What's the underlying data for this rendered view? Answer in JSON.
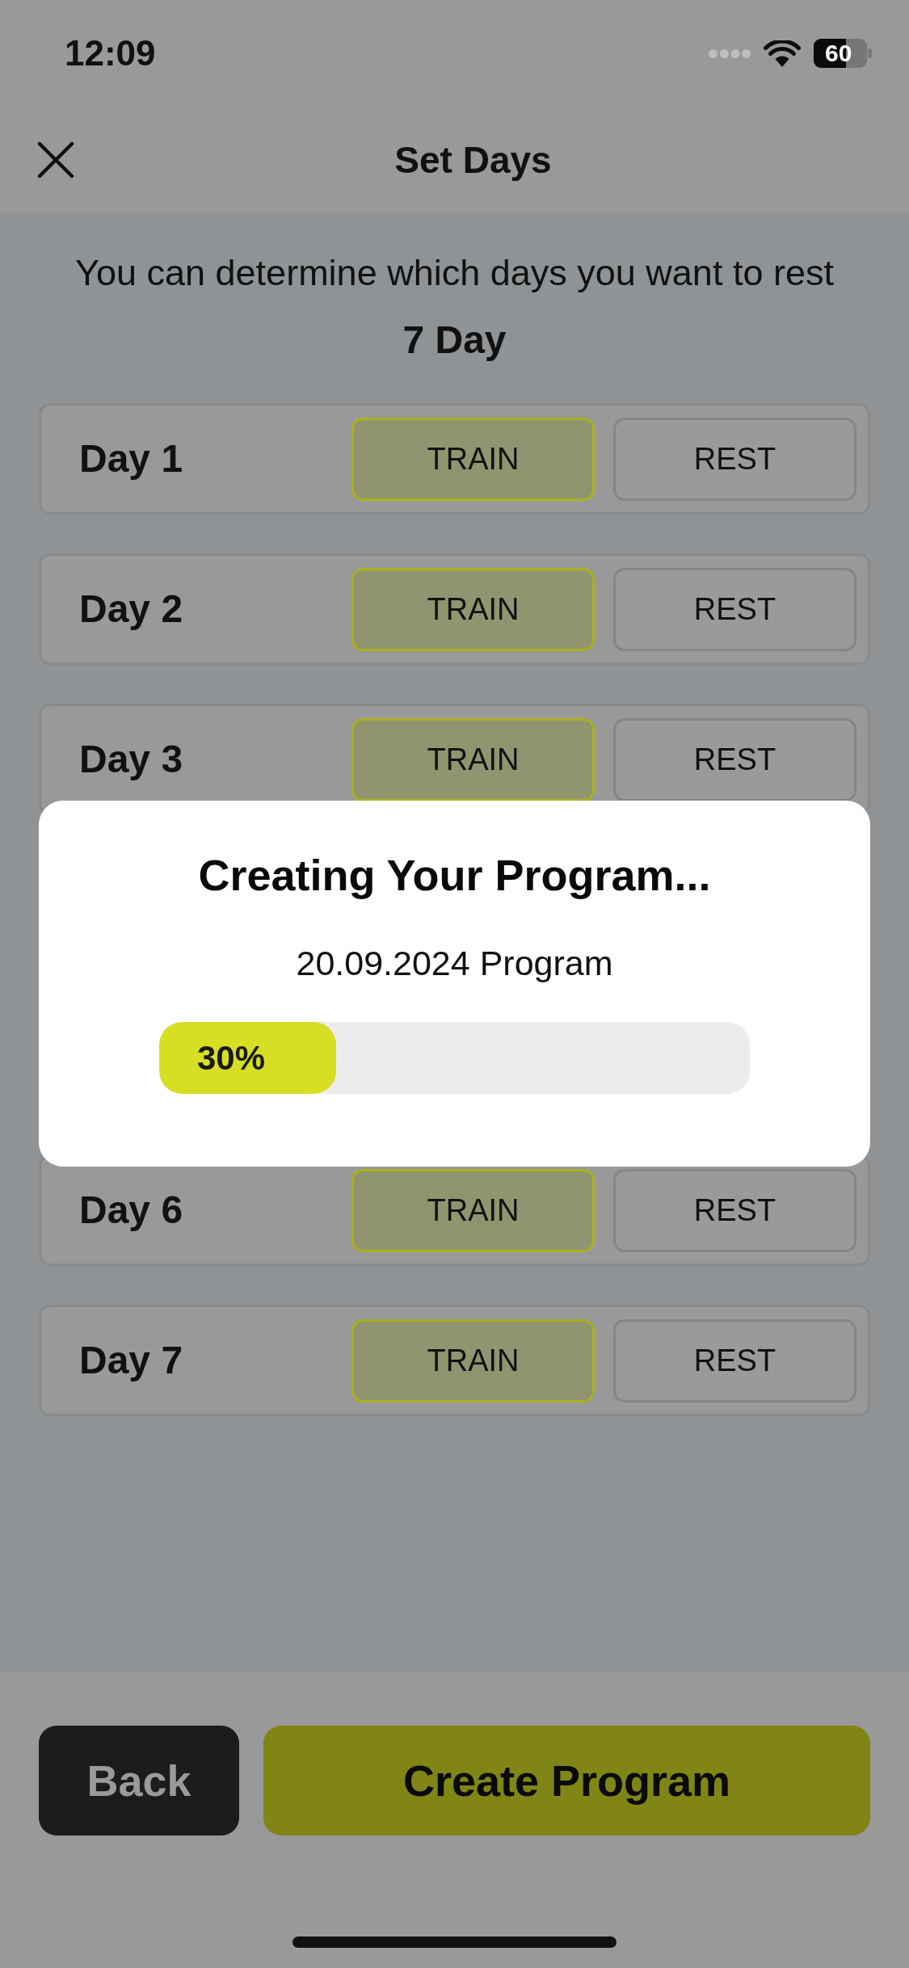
{
  "status_bar": {
    "time": "12:09",
    "battery": "60"
  },
  "header": {
    "title": "Set Days"
  },
  "intro": {
    "text": "You can determine which days you want to rest",
    "day_count": "7 Day"
  },
  "days_above_dialog": [
    {
      "label": "Day 1",
      "options": [
        {
          "label": "TRAIN",
          "selected": true
        },
        {
          "label": "REST",
          "selected": false
        }
      ]
    },
    {
      "label": "Day 2",
      "options": [
        {
          "label": "TRAIN",
          "selected": true
        },
        {
          "label": "REST",
          "selected": false
        }
      ]
    },
    {
      "label": "Day 3",
      "options": [
        {
          "label": "TRAIN",
          "selected": true
        },
        {
          "label": "REST",
          "selected": false
        }
      ]
    }
  ],
  "days_below_dialog": [
    {
      "label": "Day 6",
      "options": [
        {
          "label": "TRAIN",
          "selected": true
        },
        {
          "label": "REST",
          "selected": false
        }
      ]
    },
    {
      "label": "Day 7",
      "options": [
        {
          "label": "TRAIN",
          "selected": true
        },
        {
          "label": "REST",
          "selected": false
        }
      ]
    }
  ],
  "dialog": {
    "title": "Creating Your Program...",
    "subtitle": "20.09.2024 Program",
    "progress": {
      "level": 0.3,
      "label": "30%"
    }
  },
  "footer": {
    "buttons": [
      {
        "kind": "secondary",
        "label": "Back"
      },
      {
        "kind": "primary",
        "label": "Create Program"
      }
    ]
  }
}
